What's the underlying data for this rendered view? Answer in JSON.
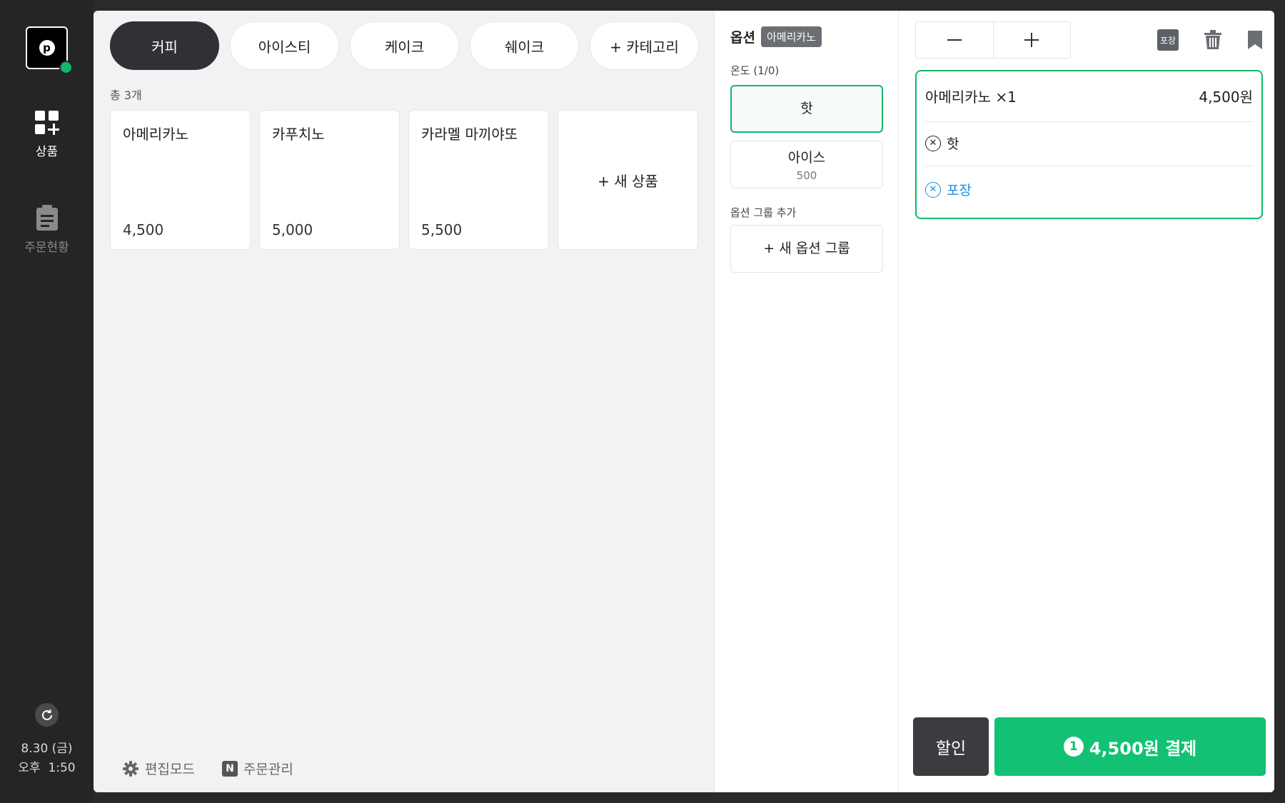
{
  "sidebar": {
    "logo_letter": "p",
    "nav": [
      {
        "label": "상품",
        "icon": "grid-plus-icon",
        "active": true
      },
      {
        "label": "주문현황",
        "icon": "clipboard-icon",
        "active": false
      }
    ],
    "date": "8.30 (금)",
    "time": "오후  1:50"
  },
  "categories": [
    {
      "label": "커피",
      "active": true
    },
    {
      "label": "아이스티",
      "active": false
    },
    {
      "label": "케이크",
      "active": false
    },
    {
      "label": "쉐이크",
      "active": false
    },
    {
      "label": "+ 카테고리",
      "active": false
    }
  ],
  "product_list": {
    "total_label": "총 3개",
    "items": [
      {
        "name": "아메리카노",
        "price": "4,500"
      },
      {
        "name": "카푸치노",
        "price": "5,000"
      },
      {
        "name": "카라멜 마끼야또",
        "price": "5,500"
      }
    ],
    "new_label": "+ 새 상품"
  },
  "footer": {
    "edit_mode": "편집모드",
    "order_manage": "주문관리",
    "order_manage_badge": "N"
  },
  "options": {
    "title": "옵션",
    "product_tag": "아메리카노",
    "group_label": "온도 (1/0)",
    "choices": [
      {
        "label": "핫",
        "price": "",
        "selected": true
      },
      {
        "label": "아이스",
        "price": "500",
        "selected": false
      }
    ],
    "add_group_label": "옵션 그룹 추가",
    "new_group_label": "+ 새 옵션 그룹"
  },
  "cart": {
    "pack_chip": "포장",
    "item_name": "아메리카노 ×1",
    "item_price": "4,500원",
    "item_options": [
      {
        "label": "핫",
        "type": "default"
      },
      {
        "label": "포장",
        "type": "pack"
      }
    ],
    "discount_label": "할인",
    "pay_count": "1",
    "pay_label": "4,500원 결제"
  },
  "colors": {
    "accent": "#12c173",
    "selected_border": "#12b76a",
    "pack_option": "#1a8fe3",
    "sidebar": "#252525",
    "main_bg": "#f1f2f4"
  }
}
